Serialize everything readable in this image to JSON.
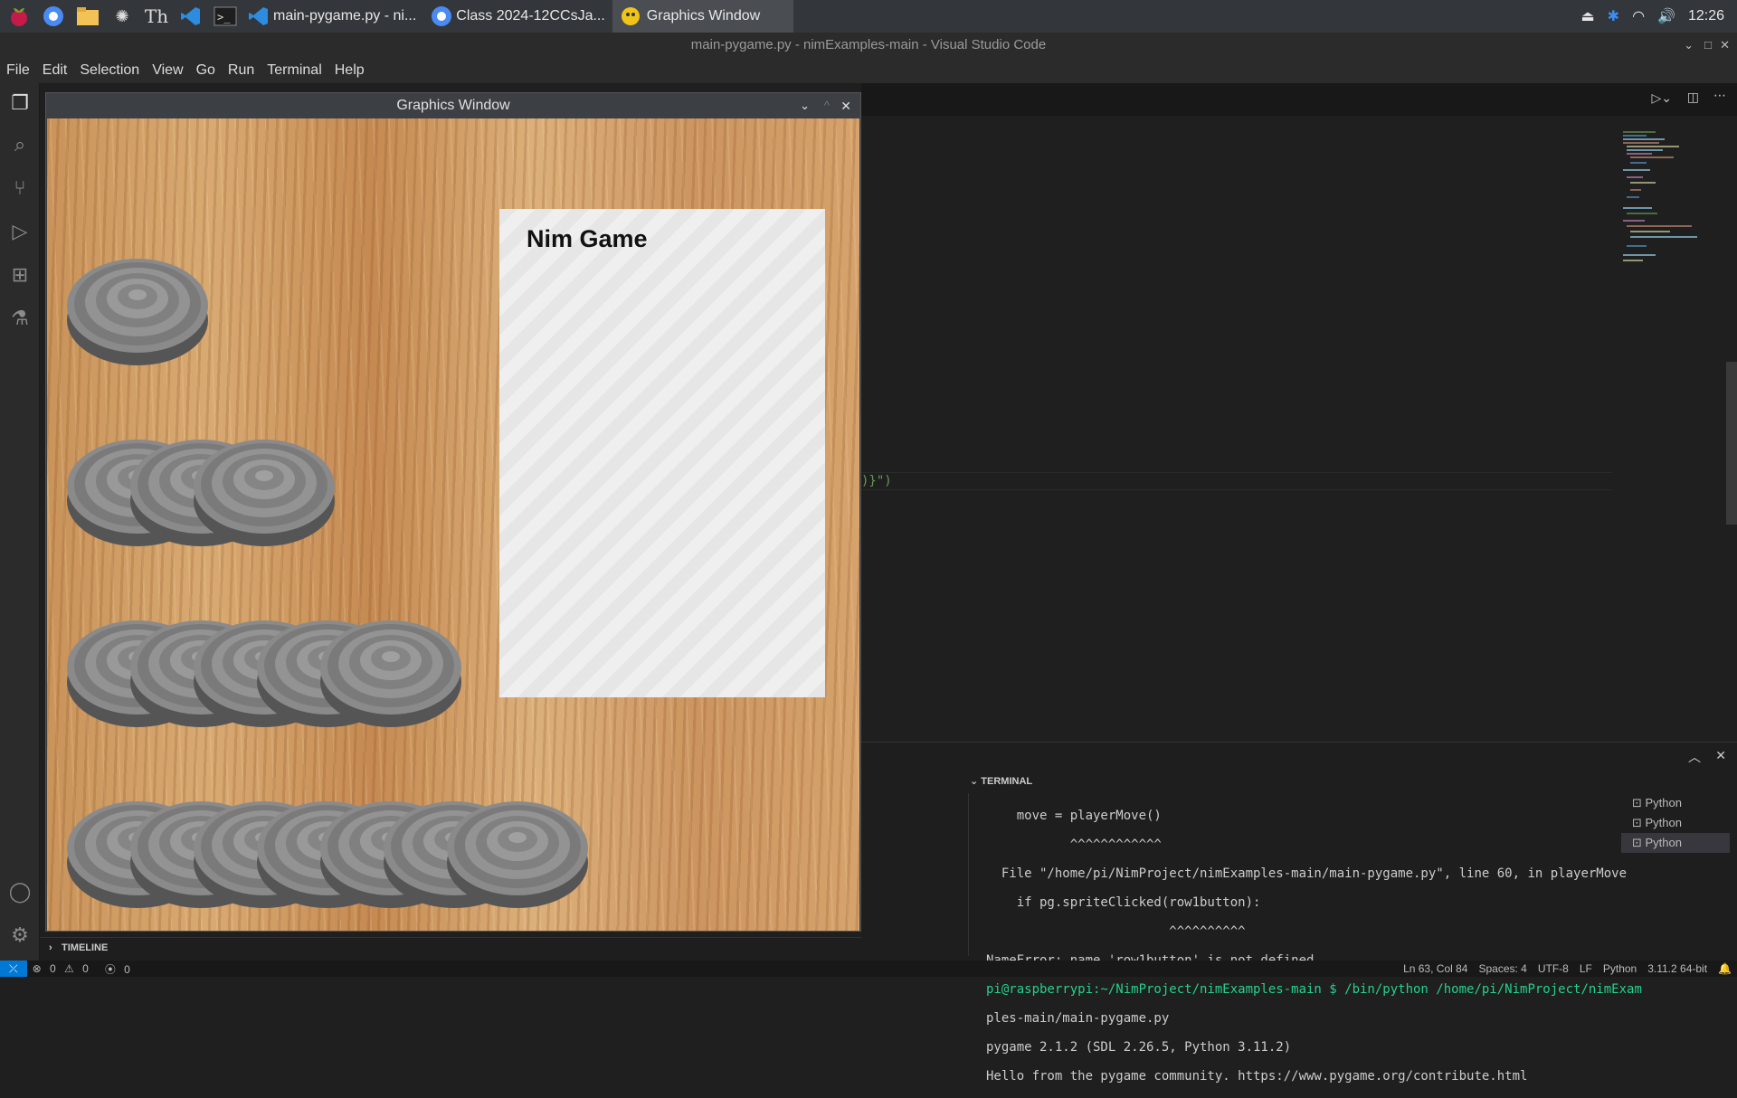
{
  "taskbar": {
    "tasks": [
      {
        "label": "main-pygame.py - ni...",
        "icon": "vscode-icon"
      },
      {
        "label": "Class 2024-12CCsJa...",
        "icon": "browser-icon"
      },
      {
        "label": "Graphics Window",
        "icon": "pygame-icon"
      }
    ],
    "clock": "12:26"
  },
  "vscode": {
    "title": "main-pygame.py - nimExamples-main - Visual Studio Code",
    "menu": [
      "File",
      "Edit",
      "Selection",
      "View",
      "Go",
      "Run",
      "Terminal",
      "Help"
    ],
    "code_fragment": ")}\")",
    "panel": {
      "title": "TERMINAL",
      "terminals": [
        "Python",
        "Python",
        "Python"
      ],
      "lines": [
        "    move = playerMove()",
        "           ^^^^^^^^^^^^",
        "  File \"/home/pi/NimProject/nimExamples-main/main-pygame.py\", line 60, in playerMove",
        "    if pg.spriteClicked(row1button):",
        "                        ^^^^^^^^^^",
        "NameError: name 'row1button' is not defined",
        "pi@raspberrypi:~/NimProject/nimExamples-main $ /bin/python /home/pi/NimProject/nimExam",
        "ples-main/main-pygame.py",
        "pygame 2.1.2 (SDL 2.26.5, Python 3.11.2)",
        "Hello from the pygame community. https://www.pygame.org/contribute.html"
      ]
    },
    "timeline": "TIMELINE",
    "status": {
      "errors": "0",
      "warnings": "0",
      "ports": "0",
      "position": "Ln 63, Col 84",
      "spaces": "Spaces: 4",
      "encoding": "UTF-8",
      "eol": "LF",
      "language": "Python",
      "interpreter": "3.11.2 64-bit"
    }
  },
  "graphics_window": {
    "title": "Graphics Window",
    "paper_title": "Nim Game",
    "rows": [
      1,
      3,
      5,
      7
    ]
  }
}
